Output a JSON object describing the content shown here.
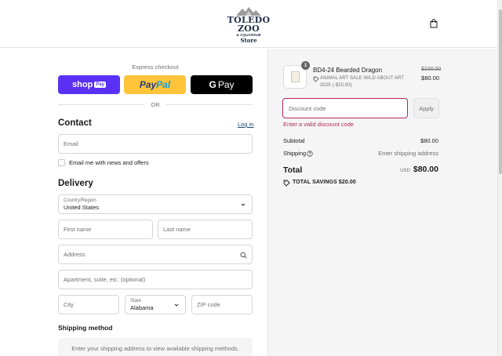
{
  "header": {
    "logo_title": "TOLEDO ZOO",
    "logo_subtitle": "& AQUARIUM",
    "logo_store": "Store",
    "cart_icon": "shopping-bag-icon"
  },
  "express": {
    "title": "Express checkout",
    "shop_pay_label": "shop",
    "shop_pay_badge": "Pay",
    "paypal_pay": "Pay",
    "paypal_pal": "Pal",
    "gpay_g": "G",
    "gpay_label": "Pay",
    "or_text": "OR"
  },
  "contact": {
    "heading": "Contact",
    "login_link": "Log in",
    "email_placeholder": "Email",
    "newsletter_label": "Email me with news and offers"
  },
  "delivery": {
    "heading": "Delivery",
    "country_label": "Country/Region",
    "country_value": "United States",
    "first_name_placeholder": "First name",
    "last_name_placeholder": "Last name",
    "address_placeholder": "Address",
    "apartment_placeholder": "Apartment, suite, etc. (optional)",
    "city_placeholder": "City",
    "state_label": "State",
    "state_value": "Alabama",
    "zip_placeholder": "ZIP code"
  },
  "shipping_method": {
    "heading": "Shipping method",
    "message": "Enter your shipping address to view available shipping methods."
  },
  "order": {
    "item": {
      "quantity": "1",
      "name": "BD4-24 Bearded Dragon",
      "discount_tag": "ANIMAL ART SALE WILD ABOUT ART 2025 (-$20.00)",
      "original_price": "$100.00",
      "price": "$80.00"
    },
    "discount_placeholder": "Discount code",
    "apply_label": "Apply",
    "discount_error": "Enter a valid discount code",
    "subtotal_label": "Subtotal",
    "subtotal_value": "$80.00",
    "shipping_label": "Shipping",
    "shipping_value": "Enter shipping address",
    "total_label": "Total",
    "currency": "USD",
    "total_value": "$80.00",
    "savings_label": "TOTAL SAVINGS",
    "savings_value": "$20.00"
  },
  "colors": {
    "accent_error": "#b1265f",
    "shop_pay": "#5a31f4",
    "paypal": "#ffc439",
    "gpay": "#000000",
    "link": "#1a4a6e"
  }
}
